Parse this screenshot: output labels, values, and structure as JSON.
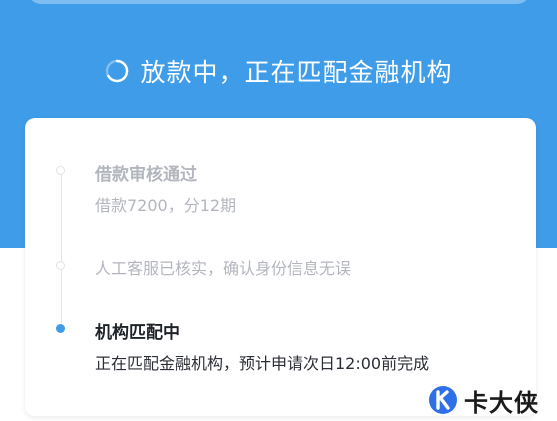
{
  "header": {
    "status_text": "放款中，正在匹配金融机构",
    "status_icon": "spinner-icon"
  },
  "steps": [
    {
      "title": "借款审核通过",
      "desc": "借款7200，分12期",
      "state": "done"
    },
    {
      "title": "",
      "desc": "人工客服已核实，确认身份信息无误",
      "state": "done"
    },
    {
      "title": "机构匹配中",
      "desc": "正在匹配金融机构，预计申请次日12:00前完成",
      "state": "active"
    }
  ],
  "watermark": {
    "text": "卡大侠",
    "logo_icon": "k-logo-icon"
  },
  "colors": {
    "brand_blue": "#3f9ce8",
    "muted_text": "#b3b7bd",
    "active_text": "#1f2329"
  }
}
